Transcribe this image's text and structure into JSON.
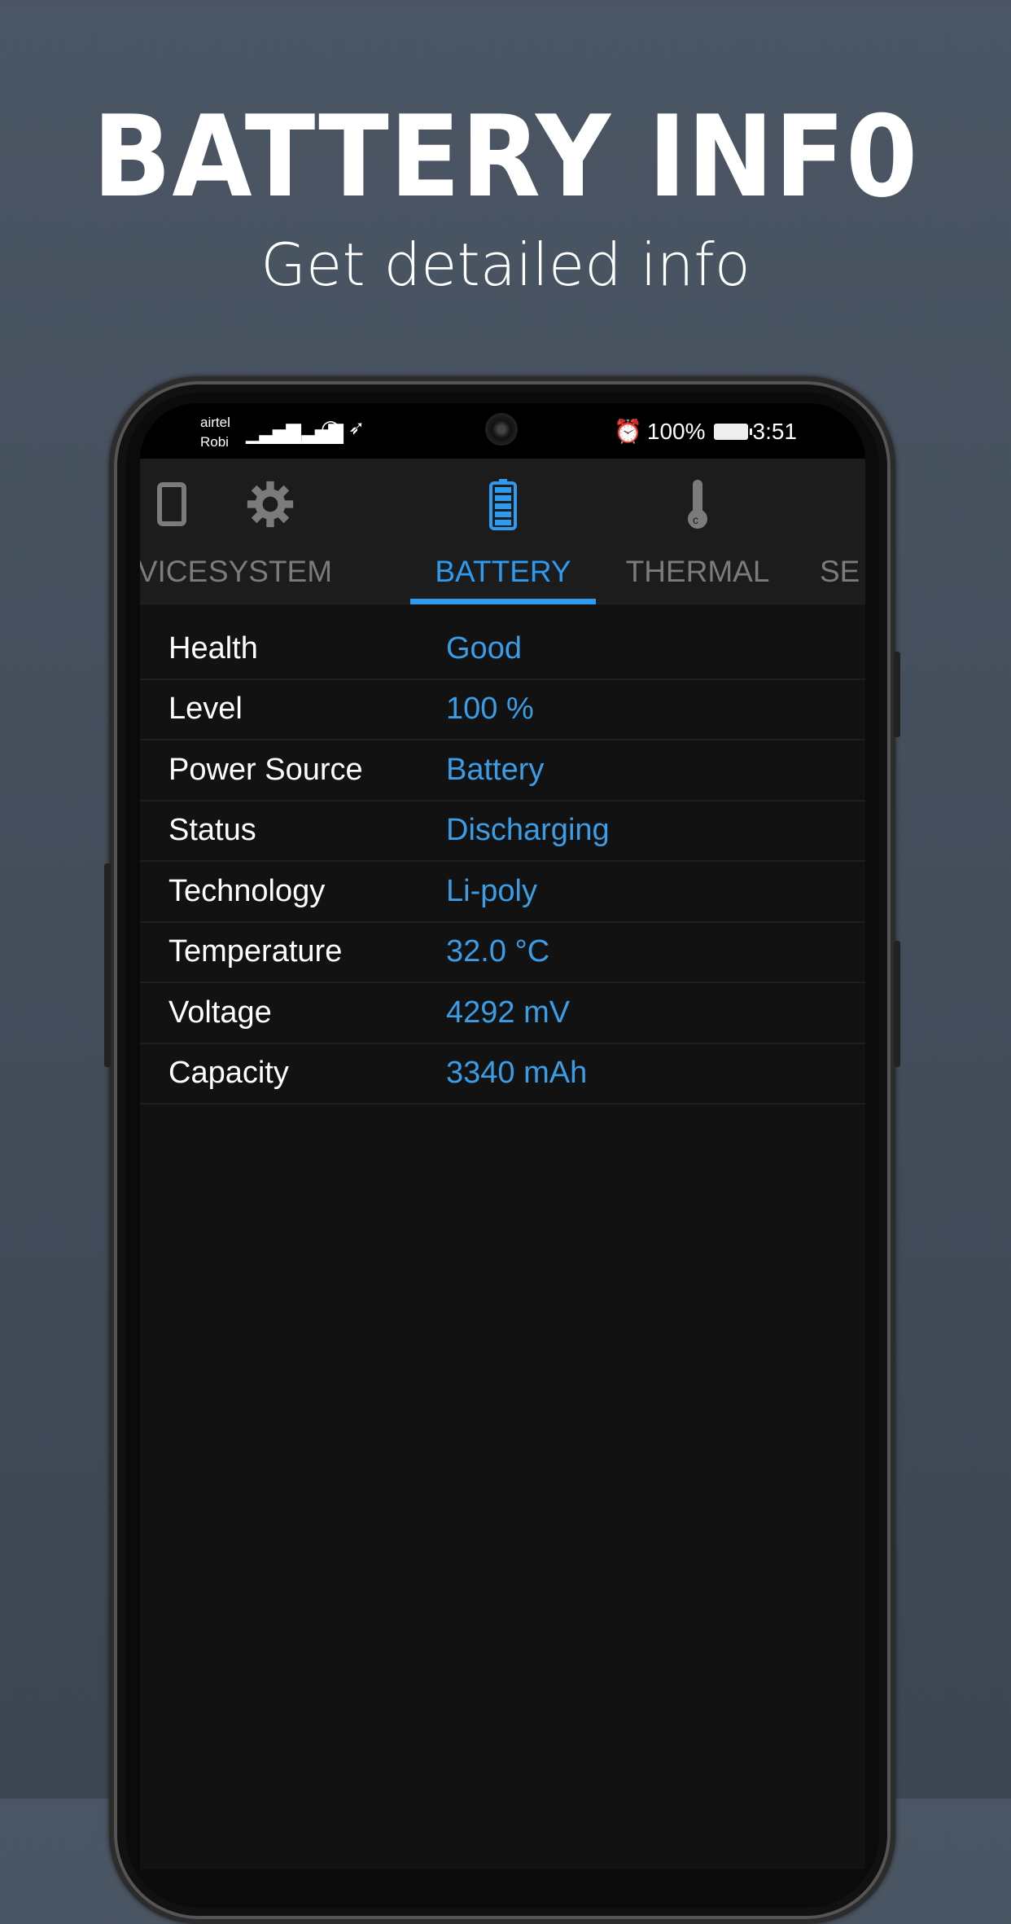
{
  "promo": {
    "title": "BATTERY INF0",
    "subtitle": "Get detailed info"
  },
  "status_bar": {
    "carrier1": "airtel",
    "carrier2": "Robi",
    "battery": "100%",
    "time": "3:51"
  },
  "tabs": [
    {
      "label": "VICE",
      "icon": "phone-icon",
      "active": false
    },
    {
      "label": "SYSTEM",
      "icon": "gear-icon",
      "active": false
    },
    {
      "label": "BATTERY",
      "icon": "battery-icon",
      "active": true
    },
    {
      "label": "THERMAL",
      "icon": "thermometer-icon",
      "active": false
    },
    {
      "label": "SE",
      "icon": "",
      "active": false
    }
  ],
  "accent_color": "#2e9bf0",
  "rows": [
    {
      "label": "Health",
      "value": "Good"
    },
    {
      "label": "Level",
      "value": "100 %"
    },
    {
      "label": "Power Source",
      "value": "Battery"
    },
    {
      "label": "Status",
      "value": "Discharging"
    },
    {
      "label": "Technology",
      "value": "Li-poly"
    },
    {
      "label": "Temperature",
      "value": "32.0 °C"
    },
    {
      "label": "Voltage",
      "value": "4292 mV"
    },
    {
      "label": "Capacity",
      "value": "3340 mAh"
    }
  ]
}
